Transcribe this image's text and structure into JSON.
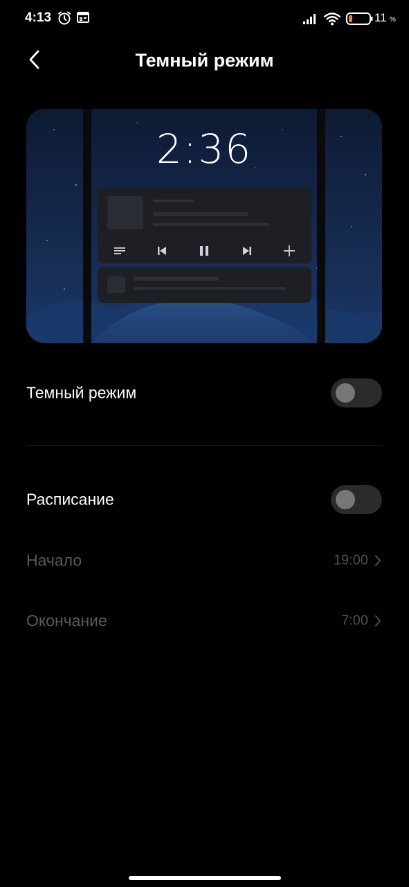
{
  "status_bar": {
    "time": "4:13",
    "battery_percent": "11",
    "battery_percent_sign": "%",
    "icons": [
      "alarm-icon",
      "calendar-icon",
      "signal-icon",
      "wifi-icon",
      "battery-icon"
    ]
  },
  "header": {
    "title": "Темный режим",
    "back_icon": "chevron-left-icon"
  },
  "preview": {
    "clock": "2:36",
    "controls": [
      "playlist-icon",
      "previous-icon",
      "pause-icon",
      "next-icon",
      "add-icon"
    ]
  },
  "settings": {
    "dark_mode": {
      "label": "Темный режим",
      "enabled": false
    },
    "schedule": {
      "label": "Расписание",
      "enabled": false
    },
    "start": {
      "label": "Начало",
      "value": "19:00"
    },
    "end": {
      "label": "Окончание",
      "value": "7:00"
    }
  },
  "colors": {
    "background": "#000000",
    "toggle_off_track": "#2b2b2b",
    "toggle_off_knob": "#777777",
    "dim_text": "#5a5a5a"
  }
}
